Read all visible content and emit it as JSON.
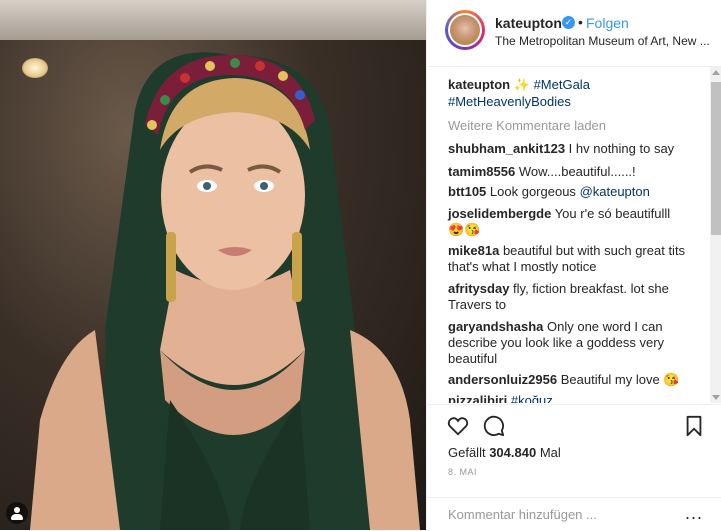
{
  "post": {
    "username": "kateupton",
    "follow_label": "Folgen",
    "location": "The Metropolitan Museum of Art, New ...",
    "caption_user": "kateupton",
    "caption_emoji": "✨",
    "caption_tag1": "#MetGala",
    "caption_tag2": "#MetHeavenlyBodies",
    "load_more": "Weitere Kommentare laden",
    "likes_label": "Gefällt",
    "likes_count": "304.840",
    "likes_suffix": "Mal",
    "date": "8. MAI",
    "comment_placeholder": "Kommentar hinzufügen ...",
    "more_dots": "..."
  },
  "comments": [
    {
      "user": "shubham_ankit123",
      "text": "I hv nothing to say"
    },
    {
      "user": "tamim8556",
      "text": "Wow....beautiful......!"
    },
    {
      "user": "btt105",
      "text": "Look gorgeous",
      "mention": "@kateupton"
    },
    {
      "user": "joselidembergde",
      "text": "You r'e só beautifulll",
      "emoji": "😍😘"
    },
    {
      "user": "mike81a",
      "text": "beautiful but with such great tits that's what I mostly notice"
    },
    {
      "user": "afritysday",
      "text": "fly, fiction breakfast. lot she Travers to"
    },
    {
      "user": "garyandshasha",
      "text": "Only one word I can describe you look like a goddess very beautiful"
    },
    {
      "user": "andersonluiz2956",
      "text": "Beautiful my love",
      "emoji": "😘"
    },
    {
      "user": "pizzalibiri",
      "mention": "#koğuz"
    }
  ],
  "icons": {
    "heart": "heart-icon",
    "comment": "comment-icon",
    "bookmark": "bookmark-icon",
    "verified": "verified-badge-icon",
    "bag": "user-tag-icon"
  },
  "colors": {
    "link": "#003569",
    "accent": "#3897f0",
    "muted": "#999999"
  }
}
